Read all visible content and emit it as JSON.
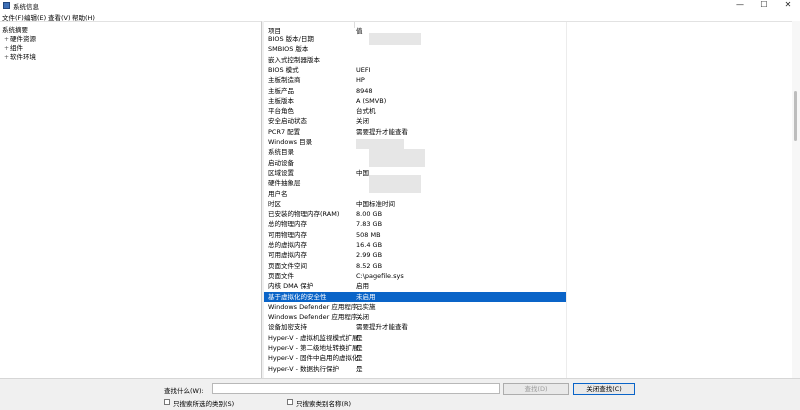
{
  "window": {
    "title": "系统信息"
  },
  "controls": {
    "minimize": "—",
    "maximize": "☐",
    "close": "✕"
  },
  "menu": [
    "文件(F)",
    "编辑(E)",
    "查看(V)",
    "帮助(H)"
  ],
  "tree": [
    {
      "label": "系统摘要",
      "exp": ""
    },
    {
      "label": "硬件资源",
      "exp": "+"
    },
    {
      "label": "组件",
      "exp": "+"
    },
    {
      "label": "软件环境",
      "exp": "+"
    }
  ],
  "table": {
    "headers": [
      "项目",
      "值"
    ],
    "rows": [
      {
        "k": "BIOS 版本/日期",
        "v": ""
      },
      {
        "k": "SMBIOS 版本",
        "v": ""
      },
      {
        "k": "嵌入式控制器版本",
        "v": ""
      },
      {
        "k": "BIOS 模式",
        "v": "UEFI"
      },
      {
        "k": "主板制造商",
        "v": "HP"
      },
      {
        "k": "主板产品",
        "v": "8948"
      },
      {
        "k": "主板版本",
        "v": "A (SMVB)"
      },
      {
        "k": "平台角色",
        "v": "台式机"
      },
      {
        "k": "安全启动状态",
        "v": "关闭"
      },
      {
        "k": "PCR7 配置",
        "v": "需要提升才能查看"
      },
      {
        "k": "Windows 目录",
        "v": ""
      },
      {
        "k": "系统目录",
        "v": ""
      },
      {
        "k": "启动设备",
        "v": ""
      },
      {
        "k": "区域设置",
        "v": "中国"
      },
      {
        "k": "硬件抽象层",
        "v": ""
      },
      {
        "k": "用户名",
        "v": ""
      },
      {
        "k": "时区",
        "v": "中国标准时间"
      },
      {
        "k": "已安装的物理内存(RAM)",
        "v": "8.00 GB"
      },
      {
        "k": "总的物理内存",
        "v": "7.83 GB"
      },
      {
        "k": "可用物理内存",
        "v": "508 MB"
      },
      {
        "k": "总的虚拟内存",
        "v": "16.4 GB"
      },
      {
        "k": "可用虚拟内存",
        "v": "2.99 GB"
      },
      {
        "k": "页面文件空间",
        "v": "8.52 GB"
      },
      {
        "k": "页面文件",
        "v": "C:\\pagefile.sys"
      },
      {
        "k": "内核 DMA 保护",
        "v": "启用"
      },
      {
        "k": "基于虚拟化的安全性",
        "v": "未启用"
      },
      {
        "k": "Windows Defender 应用程序...",
        "v": "已实施"
      },
      {
        "k": "Windows Defender 应用程序...",
        "v": "关闭"
      },
      {
        "k": "设备加密支持",
        "v": "需要提升才能查看"
      },
      {
        "k": "Hyper-V - 虚拟机监视模式扩展",
        "v": "是"
      },
      {
        "k": "Hyper-V - 第二级地址转换扩展",
        "v": "是"
      },
      {
        "k": "Hyper-V - 固件中启用的虚拟化",
        "v": "是"
      },
      {
        "k": "Hyper-V - 数据执行保护",
        "v": "是"
      }
    ],
    "selected_index": 25
  },
  "bottom": {
    "find_label": "查找什么(W):",
    "find_value": "",
    "find_button": "查找(D)",
    "close_find_button": "关闭查找(C)",
    "chk1_label": "只搜索所选的类别(S)",
    "chk2_label": "只搜索类别名称(R)"
  }
}
